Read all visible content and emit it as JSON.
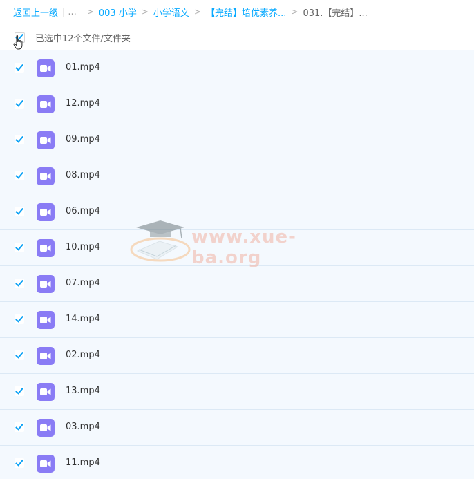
{
  "breadcrumb": {
    "back": "返回上一级",
    "ellipsis": "...",
    "items": [
      "003 小学",
      "小学语文",
      "【完结】培优素养..."
    ],
    "current": "031.【完结】..."
  },
  "selection": {
    "text": "已选中12个文件/文件夹"
  },
  "files": [
    {
      "name": "01.mp4"
    },
    {
      "name": "12.mp4"
    },
    {
      "name": "09.mp4"
    },
    {
      "name": "08.mp4"
    },
    {
      "name": "06.mp4"
    },
    {
      "name": "10.mp4"
    },
    {
      "name": "07.mp4"
    },
    {
      "name": "14.mp4"
    },
    {
      "name": "02.mp4"
    },
    {
      "name": "13.mp4"
    },
    {
      "name": "03.mp4"
    },
    {
      "name": "11.mp4"
    }
  ],
  "watermark": {
    "text": "www.xue-ba.org"
  },
  "colors": {
    "accent": "#09aaff",
    "video_icon": "#8a7cf5",
    "row_bg": "#f4f9fe"
  },
  "icons": {
    "file": "video-file-icon",
    "checkbox": "checkbox-checked-icon",
    "cursor": "hand-pointer-icon"
  }
}
